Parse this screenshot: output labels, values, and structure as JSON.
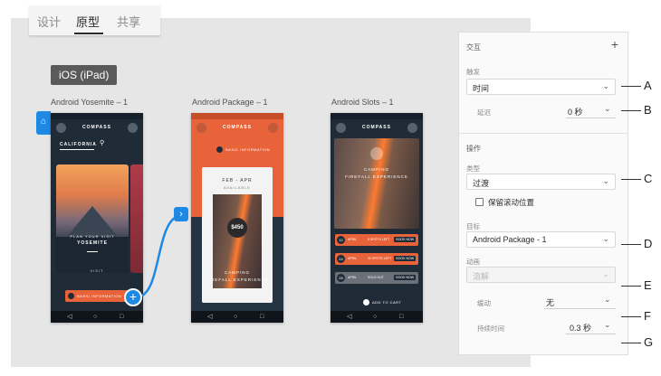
{
  "tabs": [
    {
      "label": "设计",
      "active": false
    },
    {
      "label": "原型",
      "active": true
    },
    {
      "label": "共享",
      "active": false
    }
  ],
  "device_label": "iOS (iPad)",
  "artboards": [
    {
      "title": "Android Yosemite – 1",
      "brand": "COMPASS",
      "location": "CALIFORNIA",
      "card_lines": [
        "PLAN YOUR VISIT",
        "YOSEMITE"
      ],
      "visit_label": "VISIT",
      "info_button": "BASIC INFORMATION"
    },
    {
      "title": "Android Package – 1",
      "brand": "COMPASS",
      "info_button": "BASIC INFORMATION",
      "season": "FEB - APR",
      "availability": "AVAILABLE",
      "price": "$450",
      "caption_lines": [
        "CAMPING",
        "FIREFALL EXPERIENCE"
      ]
    },
    {
      "title": "Android Slots – 1",
      "brand": "COMPASS",
      "hero_lines": [
        "CAMPING",
        "FIREFALL EXPERIENCE"
      ],
      "slots": [
        {
          "day": "12",
          "month": "APRIL",
          "status": "6 SPOTS LEFT",
          "action": "BOOK NOW",
          "color": "#e8633a"
        },
        {
          "day": "24",
          "month": "APRIL",
          "status": "20 SPOTS LEFT",
          "action": "BOOK NOW",
          "color": "#e8633a"
        },
        {
          "day": "28",
          "month": "APRIL",
          "status": "SOLD OUT",
          "action": "BOOK NOW",
          "color": "#6b7178"
        }
      ],
      "cart_label": "ADD TO CART"
    }
  ],
  "panel": {
    "heading": "交互",
    "add_icon": "+",
    "trigger_label": "触发",
    "trigger_value": "时间",
    "delay_label": "延迟",
    "delay_value": "0 秒",
    "action_heading": "操作",
    "type_label": "类型",
    "type_value": "过渡",
    "preserve_scroll_label": "保留滚动位置",
    "preserve_scroll_checked": false,
    "destination_label": "目标",
    "destination_value": "Android Package - 1",
    "animation_label": "动画",
    "animation_value": "溶解",
    "easing_label": "缓动",
    "easing_value": "无",
    "duration_label": "持续时间",
    "duration_value": "0.3 秒"
  },
  "callouts": [
    "A",
    "B",
    "C",
    "D",
    "E",
    "F",
    "G"
  ],
  "colors": {
    "accent": "#1e88e5",
    "orange": "#e8633a",
    "canvas": "#e6e6e6",
    "phone_dark": "#1f2c38"
  }
}
